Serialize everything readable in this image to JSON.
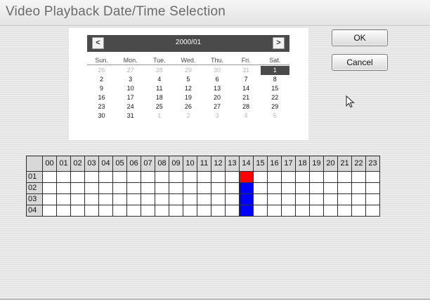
{
  "title": "Video Playback Date/Time Selection",
  "calendar": {
    "month_label": "2000/01",
    "prev_symbol": "<",
    "next_symbol": ">",
    "weekdays": [
      "Sun.",
      "Mon.",
      "Tue.",
      "Wed.",
      "Thu.",
      "Fri.",
      "Sat."
    ],
    "weeks": [
      [
        {
          "d": "26",
          "dim": true
        },
        {
          "d": "27",
          "dim": true
        },
        {
          "d": "28",
          "dim": true
        },
        {
          "d": "29",
          "dim": true
        },
        {
          "d": "30",
          "dim": true
        },
        {
          "d": "31",
          "dim": true
        },
        {
          "d": "1",
          "sel": true
        }
      ],
      [
        {
          "d": "2"
        },
        {
          "d": "3"
        },
        {
          "d": "4"
        },
        {
          "d": "5"
        },
        {
          "d": "6"
        },
        {
          "d": "7"
        },
        {
          "d": "8"
        }
      ],
      [
        {
          "d": "9"
        },
        {
          "d": "10"
        },
        {
          "d": "11"
        },
        {
          "d": "12"
        },
        {
          "d": "13"
        },
        {
          "d": "14"
        },
        {
          "d": "15"
        }
      ],
      [
        {
          "d": "16"
        },
        {
          "d": "17"
        },
        {
          "d": "18"
        },
        {
          "d": "19"
        },
        {
          "d": "20"
        },
        {
          "d": "21"
        },
        {
          "d": "22"
        }
      ],
      [
        {
          "d": "23"
        },
        {
          "d": "24"
        },
        {
          "d": "25"
        },
        {
          "d": "26"
        },
        {
          "d": "27"
        },
        {
          "d": "28"
        },
        {
          "d": "29"
        }
      ],
      [
        {
          "d": "30"
        },
        {
          "d": "31"
        },
        {
          "d": "1",
          "dim": true
        },
        {
          "d": "2",
          "dim": true
        },
        {
          "d": "3",
          "dim": true
        },
        {
          "d": "4",
          "dim": true
        },
        {
          "d": "5",
          "dim": true
        }
      ]
    ]
  },
  "buttons": {
    "ok_label": "OK",
    "cancel_label": "Cancel"
  },
  "cursor_icon": "mouse-pointer-icon",
  "time_grid": {
    "hours": [
      "00",
      "01",
      "02",
      "03",
      "04",
      "05",
      "06",
      "07",
      "08",
      "09",
      "10",
      "11",
      "12",
      "13",
      "14",
      "15",
      "16",
      "17",
      "18",
      "19",
      "20",
      "21",
      "22",
      "23"
    ],
    "rows": [
      "01",
      "02",
      "03",
      "04"
    ],
    "marked": [
      {
        "row": "01",
        "hour": "14",
        "color": "#ff0000"
      },
      {
        "row": "02",
        "hour": "14",
        "color": "#0000ff"
      },
      {
        "row": "03",
        "hour": "14",
        "color": "#0000ff"
      },
      {
        "row": "04",
        "hour": "14",
        "color": "#0000ff"
      }
    ]
  }
}
